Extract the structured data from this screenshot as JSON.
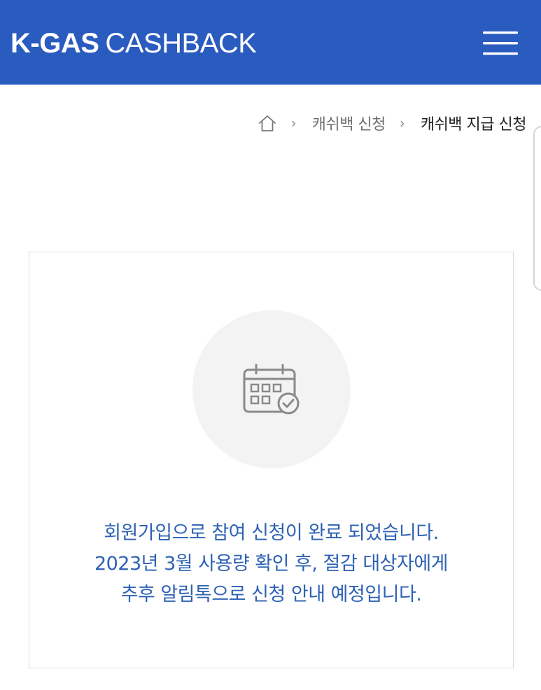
{
  "header": {
    "logo_bold": "K-GAS",
    "logo_light": "CASHBACK",
    "background_color": "#2a5bbf",
    "menu_icon": "hamburger-menu-icon"
  },
  "breadcrumb": {
    "home_icon": "home-icon",
    "separator": "›",
    "items": [
      "캐쉬백 신청",
      "캐쉬백 지급 신청"
    ]
  },
  "card": {
    "icon": "calendar-check-icon",
    "message_lines": [
      "회원가입으로 참여 신청이 완료 되었습니다.",
      "2023년 3월 사용량 확인 후, 절감 대상자에게",
      "추후 알림톡으로 신청 안내 예정입니다."
    ],
    "message_color": "#2d62b4"
  }
}
